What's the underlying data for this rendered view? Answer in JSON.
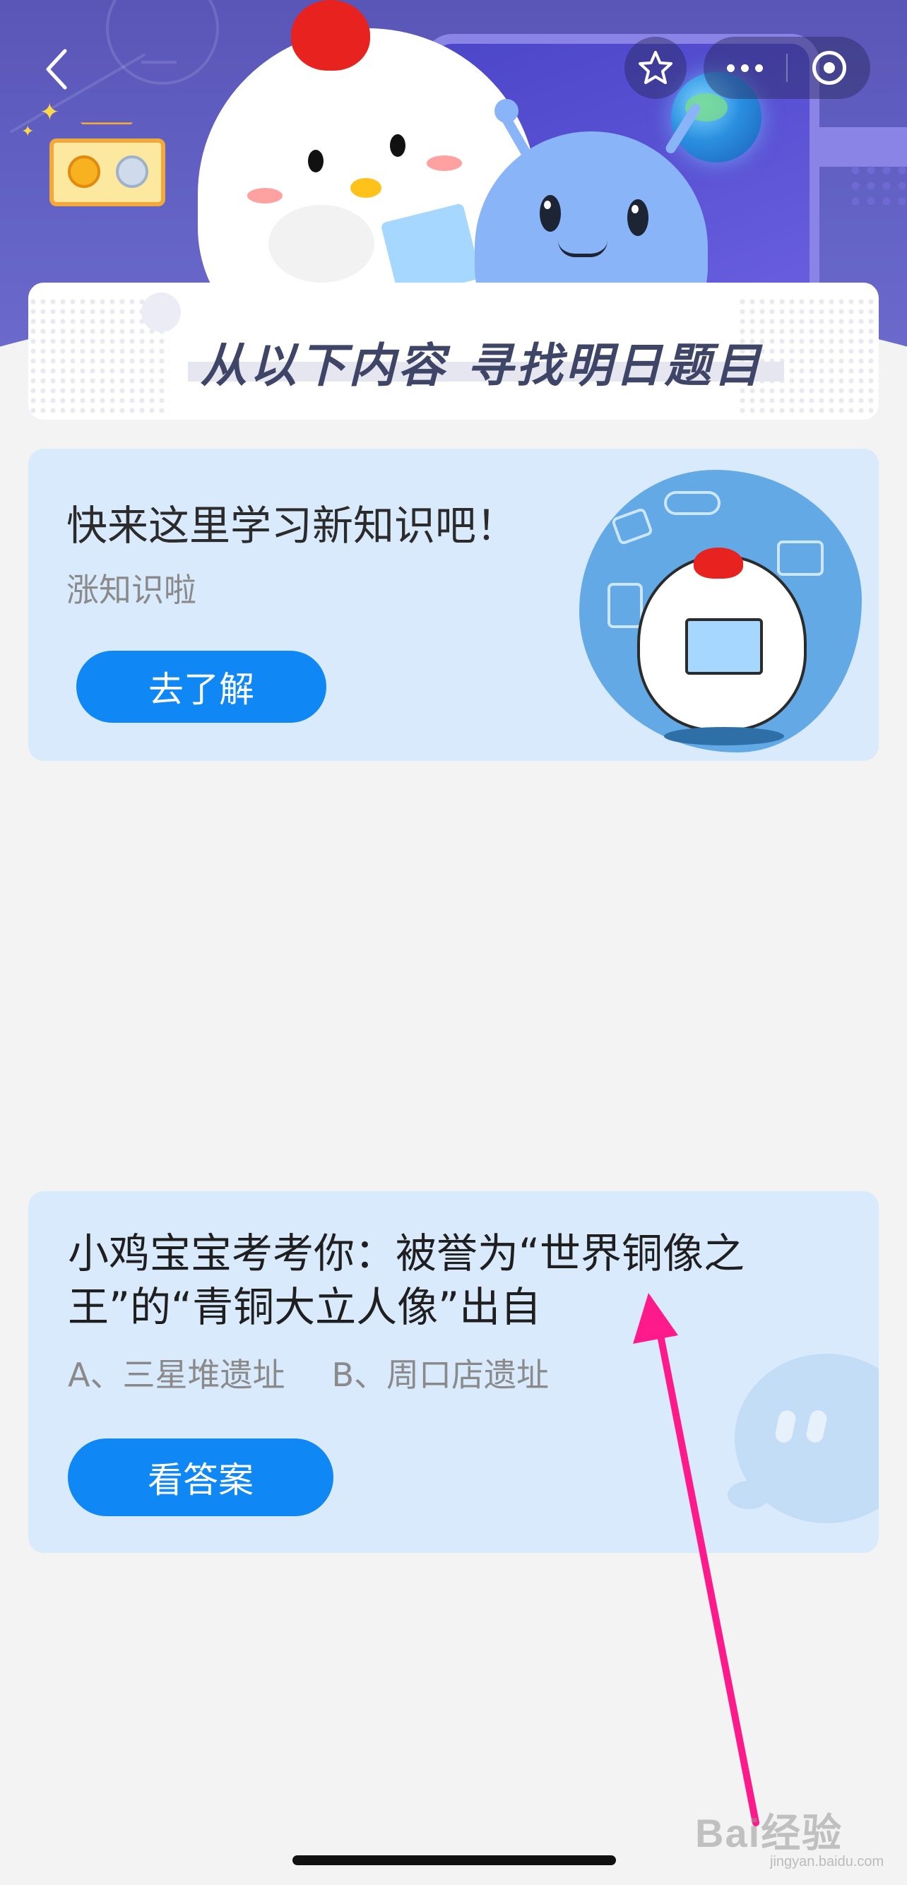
{
  "header": {
    "banner_title": "从以下内容 寻找明日题目"
  },
  "promo_card": {
    "title": "快来这里学习新知识吧！",
    "subtitle": "涨知识啦",
    "button_label": "去了解"
  },
  "quiz_card": {
    "question": "小鸡宝宝考考你：被誉为“世界铜像之王”的“青铜大立人像”出自",
    "option_a": "A、三星堆遗址",
    "option_b": "B、周口店遗址",
    "button_label": "看答案"
  },
  "watermark": {
    "brand": "Bai经验",
    "url": "jingyan.baidu.com"
  },
  "colors": {
    "header_purple": "#5a56b8",
    "card_bg": "#d9eafc",
    "button_blue": "#0f88f5",
    "annotation_arrow": "#ff1a8c"
  },
  "icons": {
    "back": "chevron-left-icon",
    "favorite": "star-icon",
    "more": "more-dots-icon",
    "close": "target-circle-icon"
  }
}
